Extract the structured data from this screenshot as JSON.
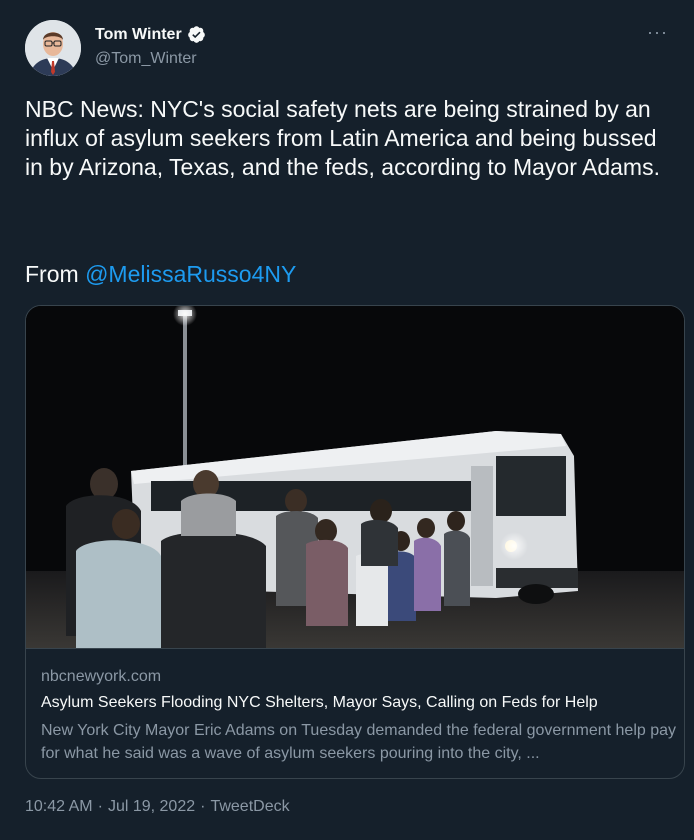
{
  "author": {
    "name": "Tom Winter",
    "handle": "@Tom_Winter",
    "verified_icon": "verified-badge-icon"
  },
  "more_icon": "more-options-icon",
  "more_glyph": "···",
  "tweet": {
    "text": "NBC News: NYC's social safety nets are being strained by an influx of asylum seekers from Latin America and being bussed in by Arizona, Texas, and the feds, according to Mayor Adams.",
    "from_prefix": "From ",
    "mention": "@MelissaRusso4NY"
  },
  "card": {
    "domain": "nbcnewyork.com",
    "title": "Asylum Seekers Flooding NYC Shelters, Mayor Says, Calling on Feds for Help",
    "description": "New York City Mayor Eric Adams on Tuesday demanded the federal government help pay for what he said was a wave of asylum seekers pouring into the city, ..."
  },
  "meta": {
    "time": "10:42 AM",
    "separator": "·",
    "date": "Jul 19, 2022",
    "source": "TweetDeck"
  },
  "colors": {
    "background": "#15202b",
    "accent": "#1d9bf0",
    "secondary_text": "#8b98a5",
    "border": "#38444d"
  }
}
